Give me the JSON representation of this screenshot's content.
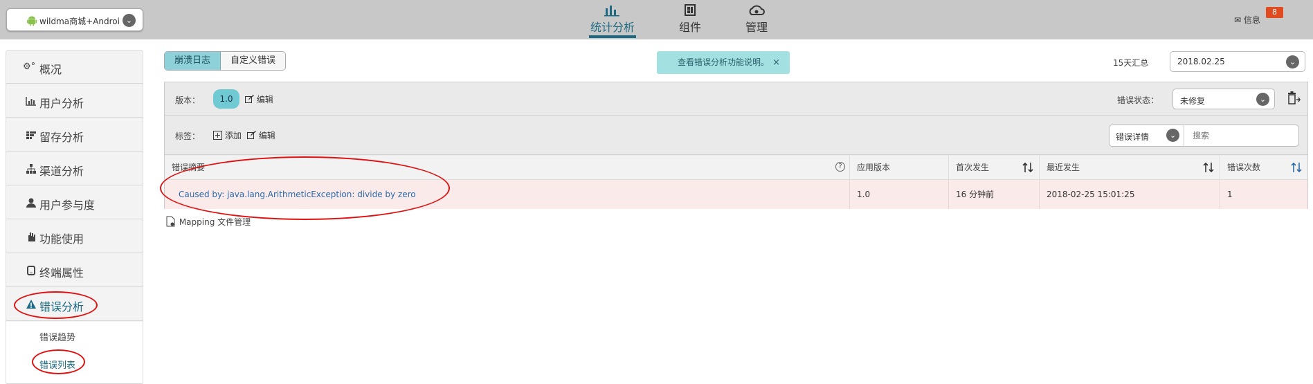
{
  "app_selector": {
    "label": "wildma商城+Androi"
  },
  "top_nav": [
    {
      "label": "统计分析",
      "active": true,
      "icon": "bar-chart-icon"
    },
    {
      "label": "组件",
      "active": false,
      "icon": "components-icon"
    },
    {
      "label": "管理",
      "active": false,
      "icon": "cloud-manage-icon"
    }
  ],
  "messages": {
    "label": "信息",
    "badge": "8"
  },
  "sidebar": {
    "items": [
      {
        "label": "概况",
        "icon": "gears-icon"
      },
      {
        "label": "用户分析",
        "icon": "bar-chart-icon"
      },
      {
        "label": "留存分析",
        "icon": "grid-icon"
      },
      {
        "label": "渠道分析",
        "icon": "sitemap-icon"
      },
      {
        "label": "用户参与度",
        "icon": "user-icon"
      },
      {
        "label": "功能使用",
        "icon": "hand-icon"
      },
      {
        "label": "终端属性",
        "icon": "tablet-icon"
      },
      {
        "label": "错误分析",
        "icon": "warning-icon",
        "active": true
      }
    ],
    "sub_items": [
      {
        "label": "错误趋势"
      },
      {
        "label": "错误列表",
        "active": true
      }
    ]
  },
  "toolbar": {
    "tabs": [
      {
        "label": "崩溃日志",
        "active": true
      },
      {
        "label": "自定义错误"
      }
    ],
    "notice": {
      "text": "查看错误分析功能说明。",
      "close": "×"
    },
    "summary_label": "15天汇总",
    "date_value": "2018.02.25"
  },
  "filters": {
    "version_label": "版本：",
    "version_value": "1.0",
    "edit_label": "编辑",
    "status_label": "错误状态：",
    "status_value": "未修复",
    "tags_label": "标签：",
    "add_label": "添加",
    "search_scope": "错误详情",
    "search_placeholder": "搜索"
  },
  "table": {
    "headers": [
      "错误摘要",
      "应用版本",
      "首次发生",
      "最近发生",
      "错误次数"
    ],
    "rows": [
      [
        "Caused by: java.lang.ArithmeticException: divide by zero",
        "1.0",
        "16 分钟前",
        "2018-02-25 15:01:25",
        "1"
      ]
    ]
  },
  "mapping_link": "Mapping 文件管理",
  "colors": {
    "accent": "#1d6a82",
    "notice_bg": "#a3e0e1",
    "annotation": "#e01010",
    "error_row": "#fbeaea"
  }
}
